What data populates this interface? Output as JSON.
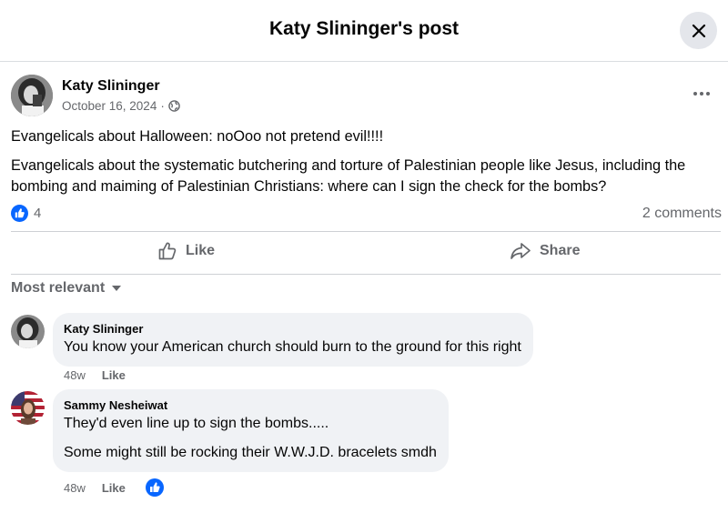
{
  "header": {
    "title": "Katy Slininger's post"
  },
  "post": {
    "author": "Katy Slininger",
    "date": "October 16, 2024",
    "separator": "·",
    "paragraphs": [
      "Evangelicals about Halloween: noOoo not pretend evil!!!!",
      "Evangelicals about the systematic butchering and torture of Palestinian people like Jesus, including the bombing and maiming of Palestinian Christians: where can I sign the check for the bombs?"
    ],
    "reaction_count": "4",
    "comments_count": "2 comments"
  },
  "actions": {
    "like": "Like",
    "share": "Share"
  },
  "comments_sort": "Most relevant",
  "comments": [
    {
      "name": "Katy Slininger",
      "lines": [
        "You know your American church should burn to the ground for this right"
      ],
      "time": "48w",
      "like": "Like"
    },
    {
      "name": "Sammy Nesheiwat",
      "lines": [
        "They'd even line up to sign the bombs.....",
        "Some might still be rocking their W.W.J.D. bracelets smdh"
      ],
      "time": "48w",
      "like": "Like"
    }
  ],
  "colors": {
    "accent": "#0866ff",
    "secondary_text": "#65676b",
    "bubble": "#f0f2f5"
  }
}
